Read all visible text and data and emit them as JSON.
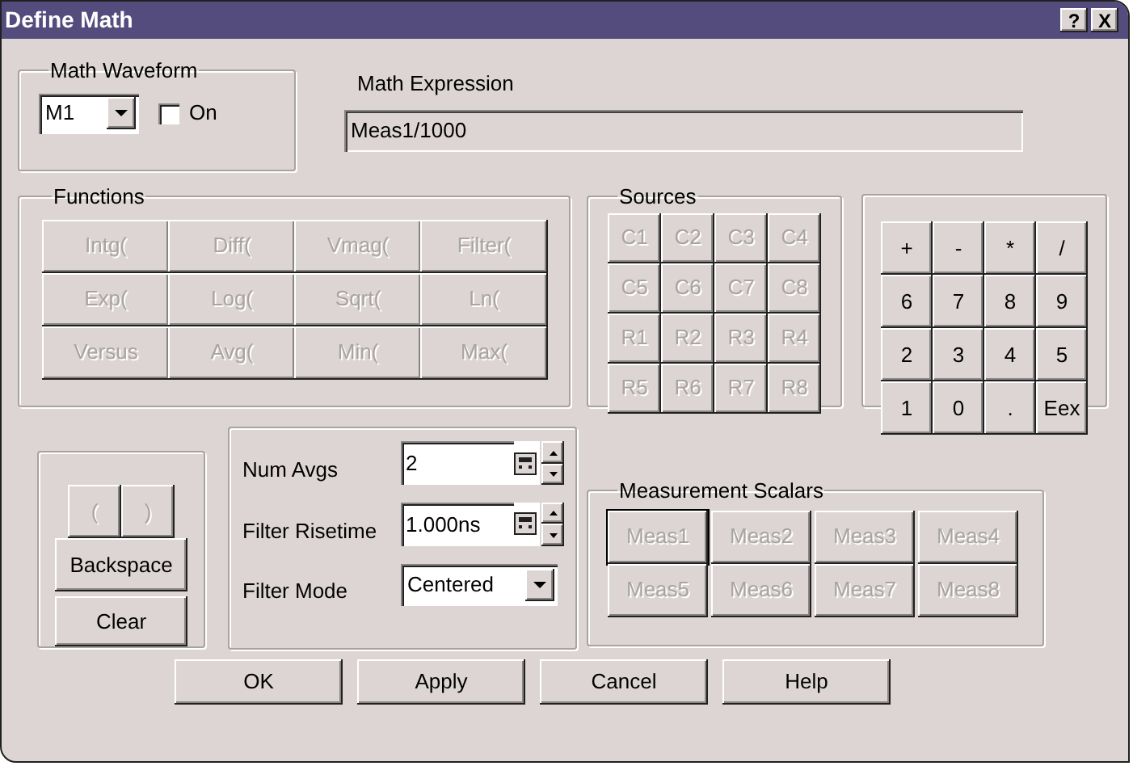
{
  "window": {
    "title": "Define Math",
    "help_button": "?",
    "close_button": "X"
  },
  "math_waveform": {
    "label": "Math Waveform",
    "value": "M1",
    "on": {
      "label": "On",
      "checked": false
    }
  },
  "math_expression": {
    "label": "Math Expression",
    "value": "Meas1/1000"
  },
  "functions": {
    "label": "Functions",
    "buttons": [
      {
        "label": "Intg(",
        "disabled": true
      },
      {
        "label": "Diff(",
        "disabled": true
      },
      {
        "label": "Vmag(",
        "disabled": true
      },
      {
        "label": "Filter(",
        "disabled": true
      },
      {
        "label": "Exp(",
        "disabled": true
      },
      {
        "label": "Log(",
        "disabled": true
      },
      {
        "label": "Sqrt(",
        "disabled": true
      },
      {
        "label": "Ln(",
        "disabled": true
      },
      {
        "label": "Versus",
        "disabled": true
      },
      {
        "label": "Avg(",
        "disabled": true
      },
      {
        "label": "Min(",
        "disabled": true
      },
      {
        "label": "Max(",
        "disabled": true
      }
    ]
  },
  "sources": {
    "label": "Sources",
    "buttons": [
      {
        "label": "C1",
        "disabled": true
      },
      {
        "label": "C2",
        "disabled": true
      },
      {
        "label": "C3",
        "disabled": true
      },
      {
        "label": "C4",
        "disabled": true
      },
      {
        "label": "C5",
        "disabled": true
      },
      {
        "label": "C6",
        "disabled": true
      },
      {
        "label": "C7",
        "disabled": true
      },
      {
        "label": "C8",
        "disabled": true
      },
      {
        "label": "R1",
        "disabled": true
      },
      {
        "label": "R2",
        "disabled": true
      },
      {
        "label": "R3",
        "disabled": true
      },
      {
        "label": "R4",
        "disabled": true
      },
      {
        "label": "R5",
        "disabled": true
      },
      {
        "label": "R6",
        "disabled": true
      },
      {
        "label": "R7",
        "disabled": true
      },
      {
        "label": "R8",
        "disabled": true
      }
    ]
  },
  "keypad": [
    {
      "label": "+",
      "disabled": false
    },
    {
      "label": "-",
      "disabled": false
    },
    {
      "label": "*",
      "disabled": false
    },
    {
      "label": "/",
      "disabled": false
    },
    {
      "label": "6",
      "disabled": false
    },
    {
      "label": "7",
      "disabled": false
    },
    {
      "label": "8",
      "disabled": false
    },
    {
      "label": "9",
      "disabled": false
    },
    {
      "label": "2",
      "disabled": false
    },
    {
      "label": "3",
      "disabled": false
    },
    {
      "label": "4",
      "disabled": false
    },
    {
      "label": "5",
      "disabled": false
    },
    {
      "label": "1",
      "disabled": false
    },
    {
      "label": "0",
      "disabled": false
    },
    {
      "label": ".",
      "disabled": false
    },
    {
      "label": "Eex",
      "disabled": false
    }
  ],
  "edit_buttons": {
    "parens": [
      {
        "label": "(",
        "disabled": true
      },
      {
        "label": ")",
        "disabled": true
      }
    ],
    "backspace": {
      "label": "Backspace",
      "disabled": false
    },
    "clear": {
      "label": "Clear",
      "disabled": false
    }
  },
  "parameters": {
    "num_avgs": {
      "label": "Num Avgs",
      "value": "2"
    },
    "filter_risetime": {
      "label": "Filter Risetime",
      "value": "1.000ns"
    },
    "filter_mode": {
      "label": "Filter Mode",
      "value": "Centered"
    }
  },
  "measurement_scalars": {
    "label": "Measurement Scalars",
    "buttons": [
      {
        "label": "Meas1",
        "disabled": true,
        "focused": true
      },
      {
        "label": "Meas2",
        "disabled": true,
        "focused": false
      },
      {
        "label": "Meas3",
        "disabled": true,
        "focused": false
      },
      {
        "label": "Meas4",
        "disabled": true,
        "focused": false
      },
      {
        "label": "Meas5",
        "disabled": true,
        "focused": false
      },
      {
        "label": "Meas6",
        "disabled": true,
        "focused": false
      },
      {
        "label": "Meas7",
        "disabled": true,
        "focused": false
      },
      {
        "label": "Meas8",
        "disabled": true,
        "focused": false
      }
    ]
  },
  "dialog_buttons": [
    {
      "label": "OK"
    },
    {
      "label": "Apply"
    },
    {
      "label": "Cancel"
    },
    {
      "label": "Help"
    }
  ]
}
